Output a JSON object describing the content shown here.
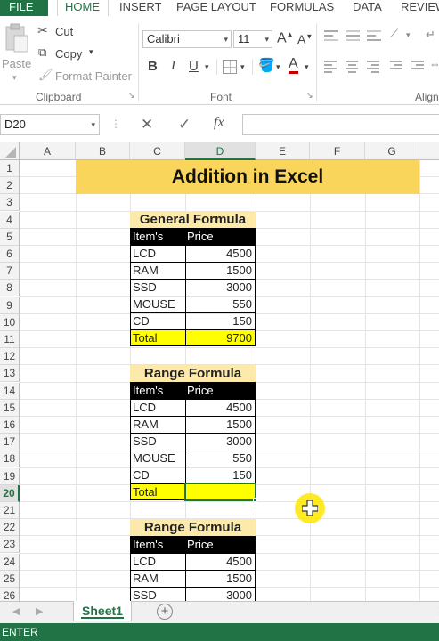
{
  "tabs": [
    {
      "label": "FILE"
    },
    {
      "label": "HOME"
    },
    {
      "label": "INSERT"
    },
    {
      "label": "PAGE LAYOUT"
    },
    {
      "label": "FORMULAS"
    },
    {
      "label": "DATA"
    },
    {
      "label": "REVIEW"
    }
  ],
  "ribbon": {
    "clipboard": {
      "paste": "Paste",
      "cut": "Cut",
      "copy": "Copy",
      "format_painter": "Format Painter",
      "label": "Clipboard"
    },
    "font": {
      "name": "Calibri",
      "size": "11",
      "bold": "B",
      "italic": "I",
      "underline": "U",
      "grow": "A",
      "shrink": "A",
      "color_letter": "A",
      "label": "Font"
    },
    "alignment": {
      "label": "Align"
    }
  },
  "formula_bar": {
    "name_box": "D20",
    "fx": "fx",
    "value": ""
  },
  "columns": [
    "A",
    "B",
    "C",
    "D",
    "E",
    "F",
    "G"
  ],
  "rows": [
    "1",
    "2",
    "3",
    "4",
    "5",
    "6",
    "7",
    "8",
    "9",
    "10",
    "11",
    "12",
    "13",
    "14",
    "15",
    "16",
    "17",
    "18",
    "19",
    "20",
    "21",
    "22",
    "23",
    "24",
    "25",
    "26"
  ],
  "sheet": {
    "banner": "Addition in Excel",
    "table1": {
      "title": "General Formula",
      "header_item": "Item's",
      "header_price": "Price",
      "rows": [
        {
          "item": "LCD",
          "price": "4500"
        },
        {
          "item": "RAM",
          "price": "1500"
        },
        {
          "item": "SSD",
          "price": "3000"
        },
        {
          "item": "MOUSE",
          "price": "550"
        },
        {
          "item": "CD",
          "price": "150"
        }
      ],
      "total_label": "Total",
      "total_value": "9700"
    },
    "table2": {
      "title": "Range Formula",
      "header_item": "Item's",
      "header_price": "Price",
      "rows": [
        {
          "item": "LCD",
          "price": "4500"
        },
        {
          "item": "RAM",
          "price": "1500"
        },
        {
          "item": "SSD",
          "price": "3000"
        },
        {
          "item": "MOUSE",
          "price": "550"
        },
        {
          "item": "CD",
          "price": "150"
        }
      ],
      "total_label": "Total",
      "total_value": ""
    },
    "table3": {
      "title": "Range Formula",
      "header_item": "Item's",
      "header_price": "Price",
      "rows": [
        {
          "item": "LCD",
          "price": "4500"
        },
        {
          "item": "RAM",
          "price": "1500"
        },
        {
          "item": "SSD",
          "price": "3000"
        }
      ]
    }
  },
  "sheet_tabs": [
    {
      "label": "Sheet1",
      "active": true
    }
  ],
  "status": {
    "mode": "ENTER"
  },
  "colors": {
    "excel_green": "#217346",
    "banner_yellow": "#fad55c",
    "total_yellow": "#ffff00",
    "title_bg": "#fde9a9"
  }
}
